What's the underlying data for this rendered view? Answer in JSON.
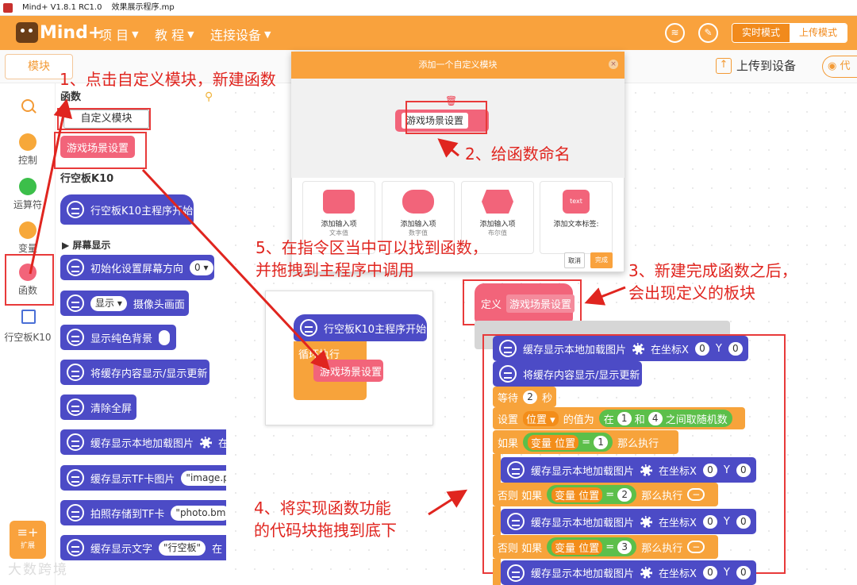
{
  "window": {
    "title": "Mind+ V1.8.1 RC1.0",
    "file": "效果展示程序.mp"
  },
  "menubar": {
    "logo_text": "Mind+",
    "menus": [
      "项 目",
      "教 程",
      "连接设备"
    ],
    "modes": {
      "realtime": "实时模式",
      "upload": "上传模式"
    }
  },
  "toolbar": {
    "modules_tab": "模块",
    "upload_to_device": "上传到设备",
    "code_tab": "代"
  },
  "categories": [
    {
      "label": "控制",
      "color": "#f7a83a"
    },
    {
      "label": "运算符",
      "color": "#3cbf4a"
    },
    {
      "label": "变量",
      "color": "#f7a83a"
    },
    {
      "label": "函数",
      "color": "#f2647a"
    },
    {
      "label": "行空板K10",
      "color": "#4a6fd6"
    }
  ],
  "extension_label": "扩展",
  "palette": {
    "functions_header": "函数",
    "custom_block_button": "自定义模块",
    "custom_function_block": "游戏场景设置",
    "k10_section": "行空板K10",
    "k10_main_block": "行空板K10主程序开始",
    "screen_section": "▶ 屏幕显示",
    "blocks": [
      {
        "label": "初始化设置屏幕方向",
        "pill": "0 ▾"
      },
      {
        "label": "摄像头画面",
        "pill": "显示 ▾"
      },
      {
        "label": "显示纯色背景",
        "pill": ""
      },
      {
        "label": "将缓存内容显示/显示更新",
        "pill": ""
      },
      {
        "label": "清除全屏",
        "pill": ""
      },
      {
        "label": "缓存显示本地加载图片",
        "pill": "在"
      },
      {
        "label": "缓存显示TF卡图片",
        "pill": "\"image.p"
      },
      {
        "label": "拍照存储到TF卡",
        "pill": "\"photo.bm"
      },
      {
        "label": "缓存显示文字",
        "pill": "\"行空板\""
      }
    ],
    "last_block_tail": "在"
  },
  "modal": {
    "title": "添加一个自定义模块",
    "function_name": "游戏场景设置",
    "options": [
      {
        "label": "添加输入项",
        "sub": "文本值"
      },
      {
        "label": "添加输入项",
        "sub": "数字值"
      },
      {
        "label": "添加输入项",
        "sub": "布尔值"
      },
      {
        "label": "添加文本标签:",
        "sub": "",
        "shape_text": "text"
      }
    ],
    "cancel": "取消",
    "done": "完成"
  },
  "mini_workspace": {
    "main_block": "行空板K10主程序开始",
    "loop_block": "循环执行",
    "dragged_block": "游戏场景设置"
  },
  "define_block": {
    "prefix": "定义",
    "name": "游戏场景设置"
  },
  "code": {
    "load_image": "缓存显示本地加载图片",
    "at_x": "在坐标X",
    "y": "Y",
    "x_val": "0",
    "y_val": "0",
    "show_update": "将缓存内容显示/显示更新",
    "wait": "等待",
    "wait_val": "2",
    "wait_unit": "秒",
    "set_var": "设置",
    "var_name": "位置 ▾",
    "value_of": "的值为",
    "random_in": "在",
    "and": "和",
    "random_tail": "之间取随机数",
    "rand_a": "1",
    "rand_b": "4",
    "if": "如果",
    "then": "那么执行",
    "else_if": "否则 如果",
    "var_block": "变量 位置",
    "eq": "=",
    "cond_1": "1",
    "cond_2": "2",
    "cond_3": "3"
  },
  "annotations": {
    "step1": "1、点击自定义模块，新建函数",
    "step2": "2、给函数命名",
    "step3_l1": "3、新建完成函数之后，",
    "step3_l2": "会出现定义的板块",
    "step4_l1": "4、将实现函数功能",
    "step4_l2": "的代码块拖拽到底下",
    "step5_l1": "5、在指令区当中可以找到函数，",
    "step5_l2": "并拖拽到主程序中调用"
  },
  "watermark": "大数跨境"
}
